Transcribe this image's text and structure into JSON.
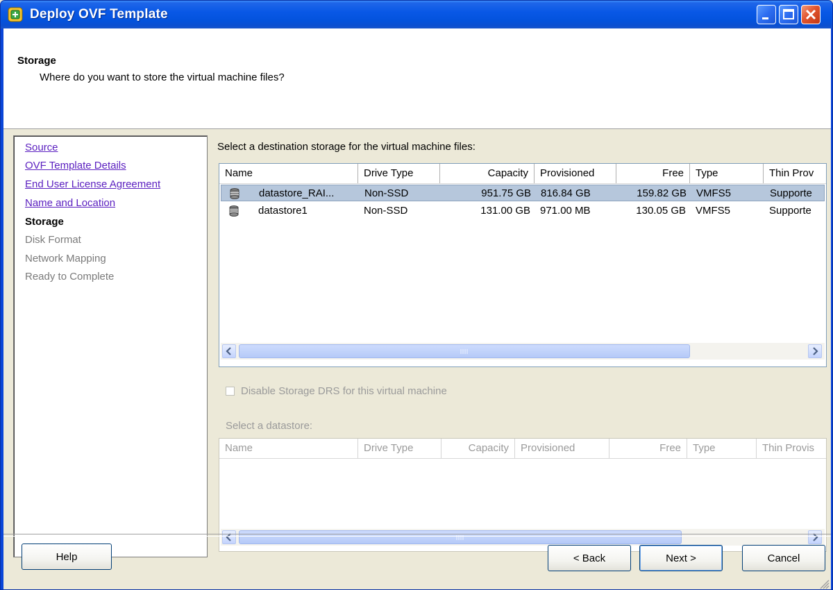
{
  "window": {
    "title": "Deploy OVF Template"
  },
  "header": {
    "title": "Storage",
    "subtitle": "Where do you want to store the virtual machine files?"
  },
  "nav": {
    "items": [
      {
        "label": "Source",
        "state": "link"
      },
      {
        "label": "OVF Template Details",
        "state": "link"
      },
      {
        "label": "End User License Agreement",
        "state": "link"
      },
      {
        "label": "Name and Location",
        "state": "link"
      },
      {
        "label": "Storage",
        "state": "current"
      },
      {
        "label": "Disk Format",
        "state": "disabled"
      },
      {
        "label": "Network Mapping",
        "state": "disabled"
      },
      {
        "label": "Ready to Complete",
        "state": "disabled"
      }
    ]
  },
  "main": {
    "instruction": "Select a destination storage for the virtual machine files:",
    "columns": [
      "Name",
      "Drive Type",
      "Capacity",
      "Provisioned",
      "Free",
      "Type",
      "Thin Prov"
    ],
    "rows": [
      {
        "name": "datastore_RAI...",
        "drive_type": "Non-SSD",
        "capacity": "951.75 GB",
        "provisioned": "816.84 GB",
        "free": "159.82 GB",
        "type": "VMFS5",
        "thin": "Supporte",
        "selected": true
      },
      {
        "name": "datastore1",
        "drive_type": "Non-SSD",
        "capacity": "131.00 GB",
        "provisioned": "971.00 MB",
        "free": "130.05 GB",
        "type": "VMFS5",
        "thin": "Supporte",
        "selected": false
      }
    ],
    "disable_drs_label": "Disable Storage DRS for this virtual machine",
    "select_datastore_label": "Select a datastore:",
    "ds_columns": [
      "Name",
      "Drive Type",
      "Capacity",
      "Provisioned",
      "Free",
      "Type",
      "Thin Provis"
    ]
  },
  "footer": {
    "help": "Help",
    "back": "< Back",
    "next": "Next >",
    "cancel": "Cancel"
  },
  "icons": {
    "app": "ovf-template-icon",
    "datastore": "database-icon",
    "minimize": "minimize-icon",
    "maximize": "maximize-icon",
    "close": "close-icon"
  },
  "colors": {
    "titlebar": "#0958e6",
    "selection": "#b6c7dc",
    "link": "#5b20c0"
  }
}
